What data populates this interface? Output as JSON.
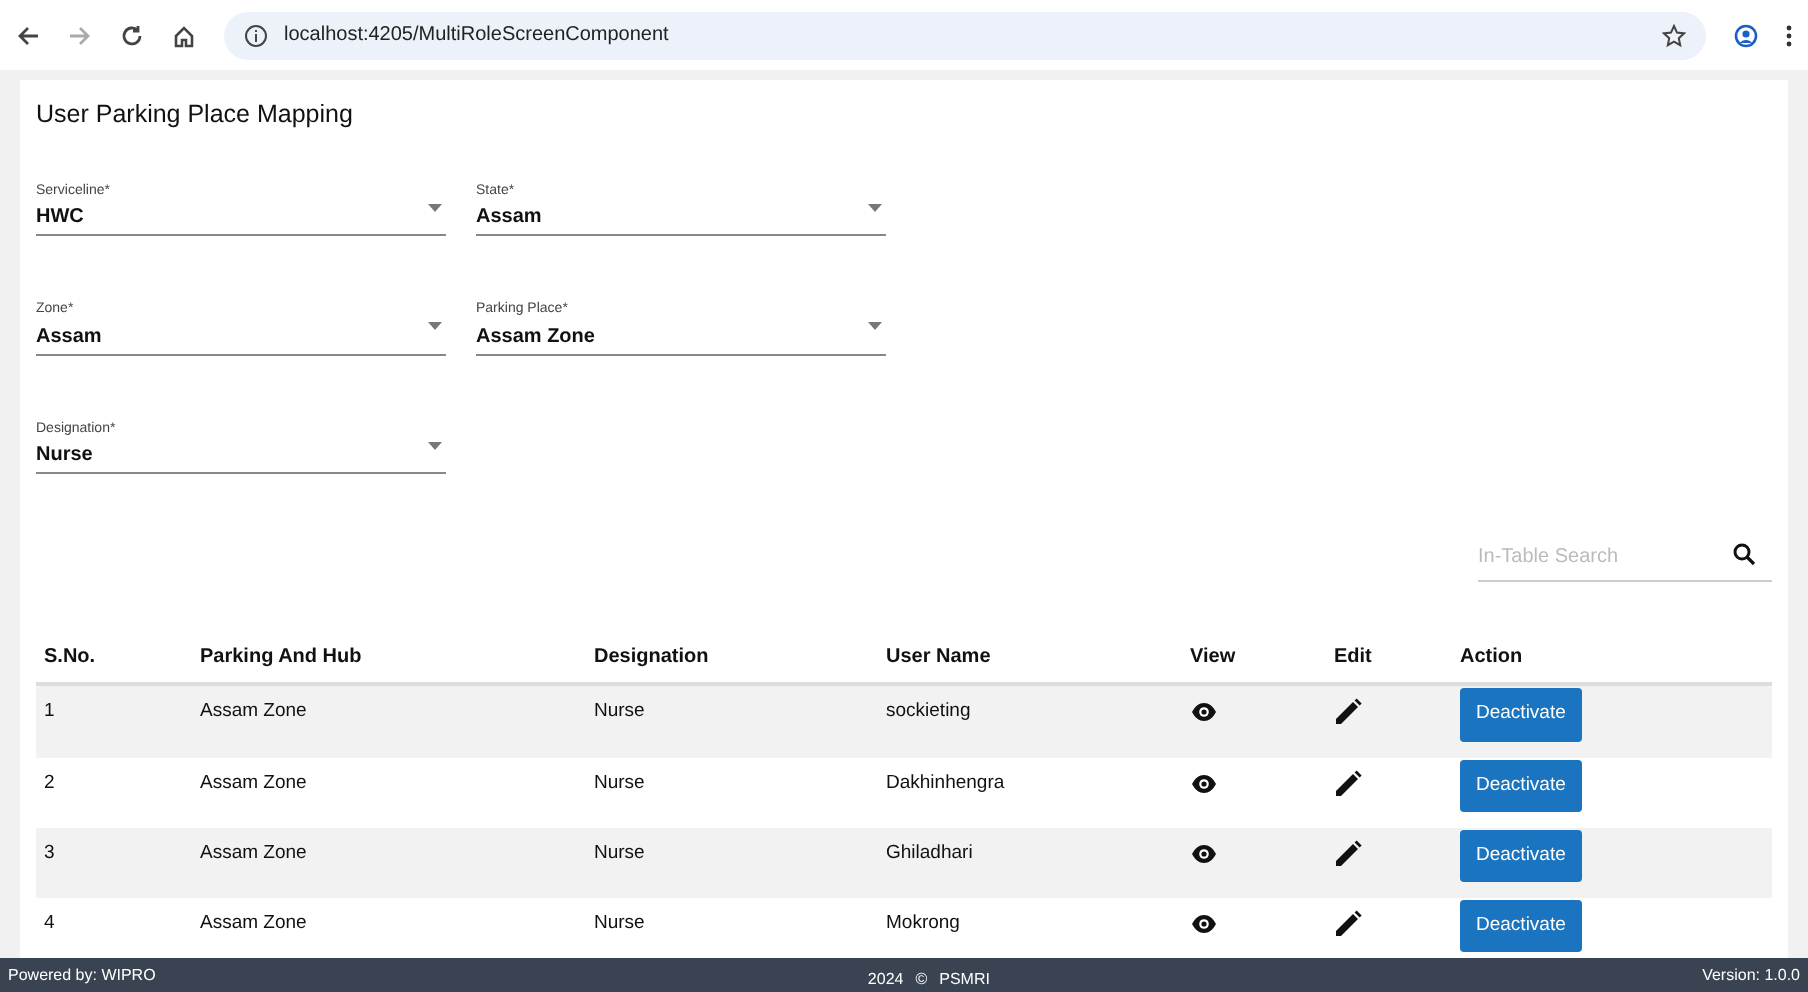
{
  "browser": {
    "url": "localhost:4205/MultiRoleScreenComponent"
  },
  "title": "User Parking Place Mapping",
  "fields": [
    {
      "label": "Serviceline*",
      "value": "HWC"
    },
    {
      "label": "State*",
      "value": "Assam"
    },
    {
      "label": "Zone*",
      "value": "Assam"
    },
    {
      "label": "Parking Place*",
      "value": "Assam Zone"
    },
    {
      "label": "Designation*",
      "value": "Nurse"
    }
  ],
  "search": {
    "placeholder": "In-Table Search"
  },
  "table": {
    "columns": [
      "S.No.",
      "Parking And Hub",
      "Designation",
      "User Name",
      "View",
      "Edit",
      "Action"
    ],
    "rows": [
      {
        "sno": "1",
        "parking": "Assam Zone",
        "designation": "Nurse",
        "user": "sockieting",
        "action": "Deactivate"
      },
      {
        "sno": "2",
        "parking": "Assam Zone",
        "designation": "Nurse",
        "user": "Dakhinhengra",
        "action": "Deactivate"
      },
      {
        "sno": "3",
        "parking": "Assam Zone",
        "designation": "Nurse",
        "user": "Ghiladhari",
        "action": "Deactivate"
      },
      {
        "sno": "4",
        "parking": "Assam Zone",
        "designation": "Nurse",
        "user": "Mokrong",
        "action": "Deactivate"
      }
    ]
  },
  "footer": {
    "powered": "Powered by: WIPRO",
    "year": "2024",
    "mark": "©",
    "org": "PSMRI",
    "version": "Version: 1.0.0"
  }
}
